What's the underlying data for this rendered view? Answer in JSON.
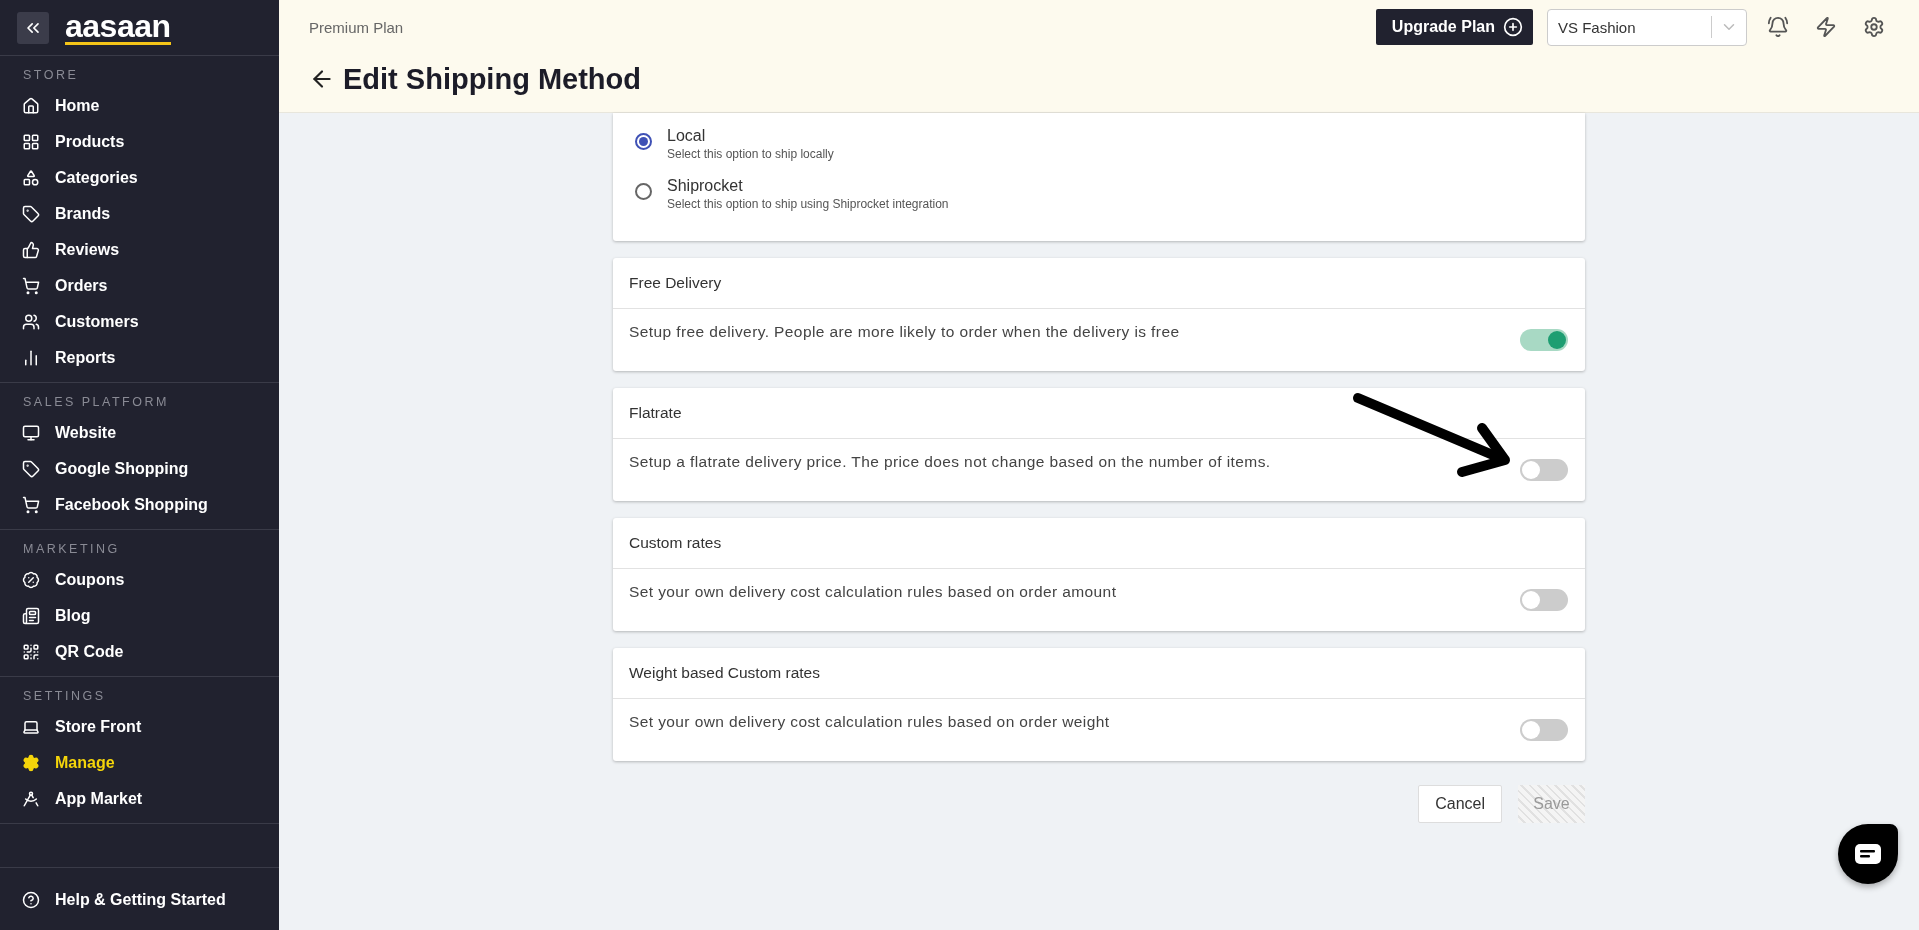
{
  "sidebar": {
    "logo": "aasaan",
    "sections": [
      {
        "title": "STORE",
        "items": [
          {
            "label": "Home",
            "selected": false
          },
          {
            "label": "Products",
            "selected": false
          },
          {
            "label": "Categories",
            "selected": false
          },
          {
            "label": "Brands",
            "selected": false
          },
          {
            "label": "Reviews",
            "selected": false
          },
          {
            "label": "Orders",
            "selected": false
          },
          {
            "label": "Customers",
            "selected": false
          },
          {
            "label": "Reports",
            "selected": false
          }
        ]
      },
      {
        "title": "SALES PLATFORM",
        "items": [
          {
            "label": "Website",
            "selected": false
          },
          {
            "label": "Google Shopping",
            "selected": false
          },
          {
            "label": "Facebook Shopping",
            "selected": false
          }
        ]
      },
      {
        "title": "MARKETING",
        "items": [
          {
            "label": "Coupons",
            "selected": false
          },
          {
            "label": "Blog",
            "selected": false
          },
          {
            "label": "QR Code",
            "selected": false
          }
        ]
      },
      {
        "title": "SETTINGS",
        "items": [
          {
            "label": "Store Front",
            "selected": false
          },
          {
            "label": "Manage",
            "selected": true
          },
          {
            "label": "App Market",
            "selected": false
          }
        ]
      }
    ],
    "footer_item": "Help & Getting Started"
  },
  "header": {
    "plan": "Premium Plan",
    "upgrade_button": "Upgrade Plan",
    "store_select": {
      "value": "VS Fashion"
    },
    "title": "Edit Shipping Method"
  },
  "shipping_options": [
    {
      "label": "Local",
      "description": "Select this option to ship locally",
      "selected": true
    },
    {
      "label": "Shiprocket",
      "description": "Select this option to ship using Shiprocket integration",
      "selected": false
    }
  ],
  "delivery_cards": [
    {
      "title": "Free Delivery",
      "description": "Setup free delivery. People are more likely to order when the delivery is free",
      "on": true
    },
    {
      "title": "Flatrate",
      "description": "Setup a flatrate delivery price. The price does not change based on the number of items.",
      "on": false
    },
    {
      "title": "Custom rates",
      "description": "Set your own delivery cost calculation rules based on order amount",
      "on": false
    },
    {
      "title": "Weight based Custom rates",
      "description": "Set your own delivery cost calculation rules based on order weight",
      "on": false
    }
  ],
  "buttons": {
    "cancel": "Cancel",
    "save": {
      "label": "Save",
      "disabled": true
    }
  }
}
